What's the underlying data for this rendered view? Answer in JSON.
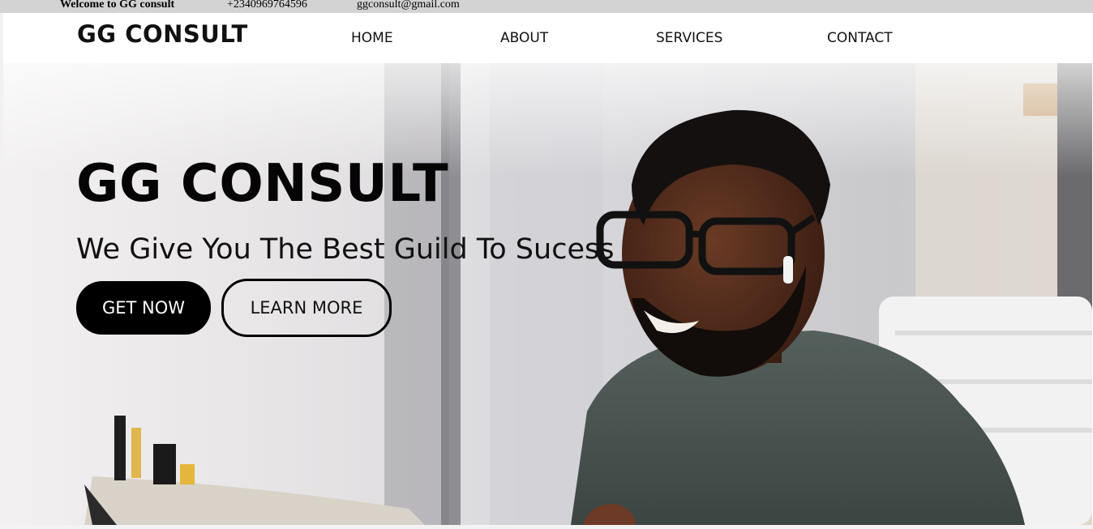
{
  "topbar": {
    "welcome": "Welcome to GG consult",
    "phone": "+2340969764596",
    "email": "ggconsult@gmail.com"
  },
  "nav": {
    "logo": "GG CONSULT",
    "links": [
      "HOME",
      "ABOUT",
      "SERVICES",
      "CONTACT"
    ]
  },
  "hero": {
    "title": "GG CONSULT",
    "subtitle": "We Give You The Best Guild To Sucess",
    "primary_button": "GET NOW",
    "secondary_button": "LEARN MORE",
    "image": "smiling-man-with-glasses-at-laptop"
  },
  "colors": {
    "topbar_bg": "#d3d3d3",
    "primary_button_bg": "#000000",
    "primary_button_text": "#ffffff",
    "text": "#000000"
  }
}
